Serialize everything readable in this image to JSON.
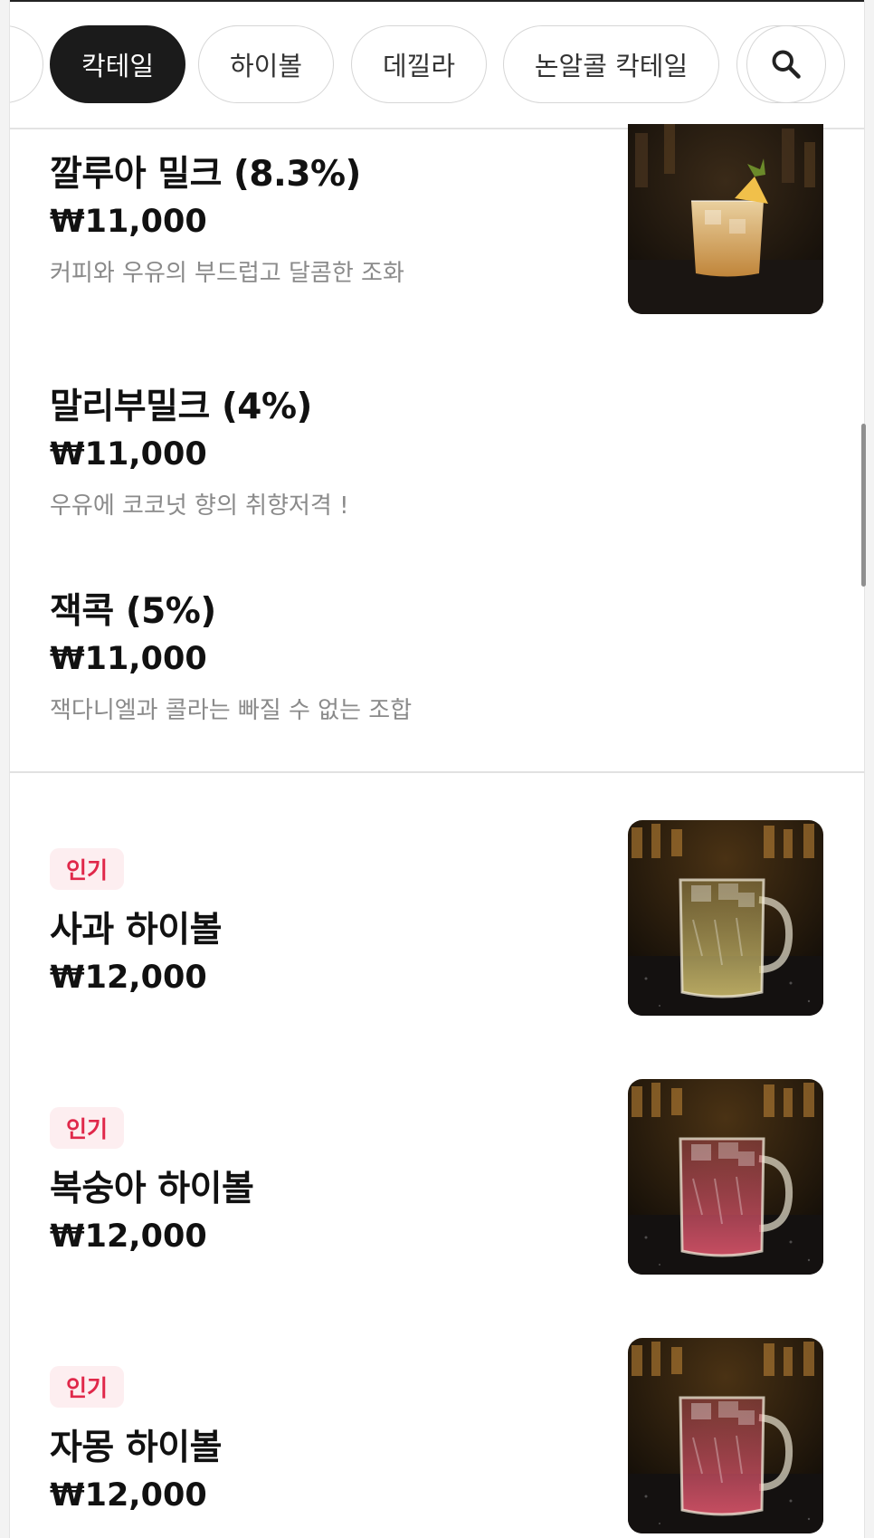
{
  "tabs": [
    {
      "label": "",
      "active": false
    },
    {
      "label": "칵테일",
      "active": true
    },
    {
      "label": "하이볼",
      "active": false
    },
    {
      "label": "데낄라",
      "active": false
    },
    {
      "label": "논알콜 칵테일",
      "active": false
    }
  ],
  "search_icon": "search-icon",
  "cocktail_items": [
    {
      "name": "깔루아 밀크 (8.3%)",
      "price": "₩11,000",
      "description": "커피와 우유의 부드럽고 달콤한 조화",
      "has_image": true
    },
    {
      "name": "말리부밀크 (4%)",
      "price": "₩11,000",
      "description": "우유에 코코넛 향의 취향저격 !",
      "has_image": false
    },
    {
      "name": "잭콕 (5%)",
      "price": "₩11,000",
      "description": "잭다니엘과 콜라는 빠질 수 없는 조합",
      "has_image": false
    }
  ],
  "highball_items": [
    {
      "badge": "인기",
      "name": "사과 하이볼",
      "price": "₩12,000",
      "drink_color": "#c9b86a"
    },
    {
      "badge": "인기",
      "name": "복숭아 하이볼",
      "price": "₩12,000",
      "drink_color": "#d9546a"
    },
    {
      "badge": "인기",
      "name": "자몽 하이볼",
      "price": "₩12,000",
      "drink_color": "#d9546a"
    }
  ],
  "colors": {
    "active_tab": "#1b1b1b",
    "badge_bg": "#fdeef0",
    "badge_text": "#e0284a",
    "description_text": "#8a8a8a"
  }
}
